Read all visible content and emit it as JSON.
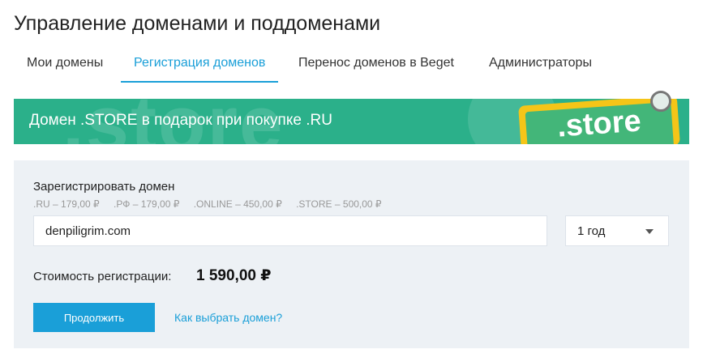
{
  "page": {
    "title": "Управление доменами и поддоменами"
  },
  "tabs": [
    {
      "label": "Мои домены",
      "active": false
    },
    {
      "label": "Регистрация доменов",
      "active": true
    },
    {
      "label": "Перенос доменов в Beget",
      "active": false
    },
    {
      "label": "Администраторы",
      "active": false
    }
  ],
  "banner": {
    "text": "Домен .STORE в подарок при покупке .RU",
    "badge": ".store",
    "background_word": ".store",
    "color": "#2bb08a",
    "badge_frame_color": "#f5c518",
    "badge_fill_color": "#43b679"
  },
  "register": {
    "label": "Зарегистрировать домен",
    "prices": [
      ".RU – 179,00 ₽",
      ".РФ – 179,00 ₽",
      ".ONLINE – 450,00 ₽",
      ".STORE – 500,00 ₽"
    ],
    "domain_value": "denpiligrim.com",
    "period_value": "1 год",
    "cost_label": "Стоимость регистрации:",
    "cost_value": "1 590,00 ₽",
    "continue_label": "Продолжить",
    "help_link": "Как выбрать домен?"
  },
  "colors": {
    "accent": "#1a9fd8",
    "panel_bg": "#edf1f5"
  }
}
